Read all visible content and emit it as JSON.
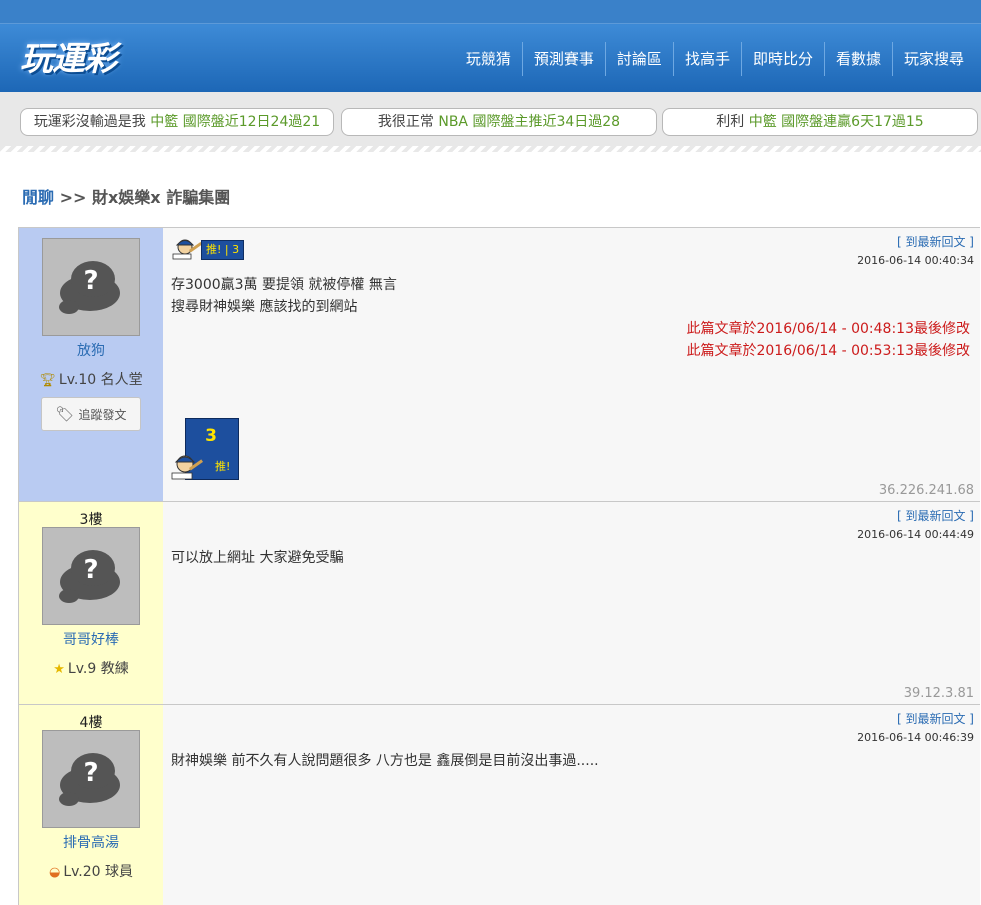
{
  "header": {
    "logo": "玩運彩",
    "nav": [
      "玩競猜",
      "預測賽事",
      "討論區",
      "找高手",
      "即時比分",
      "看數據",
      "玩家搜尋"
    ]
  },
  "ticker": [
    {
      "user": "玩運彩沒輸過是我",
      "league": "中籃",
      "stat": "國際盤近12日24過21"
    },
    {
      "user": "我很正常",
      "league": "NBA",
      "stat": "國際盤主推近34日過28"
    },
    {
      "user": "利利",
      "league": "中籃",
      "stat": "國際盤連贏6天17過15"
    }
  ],
  "breadcrumb": {
    "section": "閒聊",
    "separator": ">>",
    "title": "財x娛樂x 詐騙集團"
  },
  "posts": [
    {
      "floor": "",
      "username": "放狗",
      "level": "Lv.10 名人堂",
      "level_icon": "trophy-icon",
      "follow_label": "追蹤發文",
      "reply_label": "[ 到最新回文 ]",
      "time": "2016-06-14 00:40:34",
      "push_count": "3",
      "push_label": "推!",
      "lines": [
        "存3000贏3萬 要提領 就被停權 無言",
        "搜尋財神娛樂 應該找的到網站"
      ],
      "edits": [
        "此篇文章於2016/06/14 - 00:48:13最後修改",
        "此篇文章於2016/06/14 - 00:53:13最後修改"
      ],
      "ip": "36.226.241.68"
    },
    {
      "floor": "3樓",
      "username": "哥哥好棒",
      "level": "Lv.9 教練",
      "level_icon": "star-icon",
      "reply_label": "[ 到最新回文 ]",
      "time": "2016-06-14 00:44:49",
      "lines": [
        "可以放上網址 大家避免受騙"
      ],
      "ip": "39.12.3.81"
    },
    {
      "floor": "4樓",
      "username": "排骨高湯",
      "level": "Lv.20 球員",
      "level_icon": "ball-icon",
      "reply_label": "[ 到最新回文 ]",
      "time": "2016-06-14 00:46:39",
      "lines": [
        "財神娛樂 前不久有人說問題很多 八方也是 鑫展倒是目前沒出事過....."
      ]
    }
  ],
  "colors": {
    "header_blue": "#2f78c7",
    "op_sidebar": "#b9cbf2",
    "reply_sidebar": "#ffffcc",
    "link": "#2b6cb3",
    "edit_red": "#cc1b1b",
    "ticker_green": "#5b9a2a"
  }
}
